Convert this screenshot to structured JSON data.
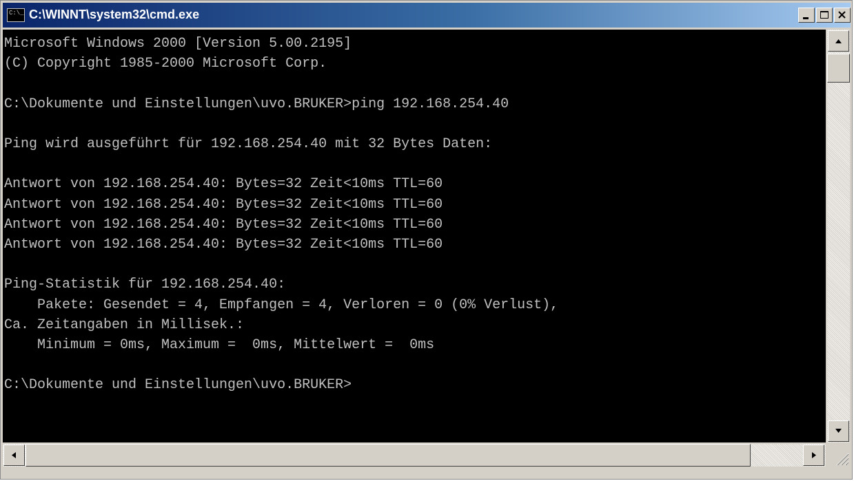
{
  "window": {
    "title": "C:\\WINNT\\system32\\cmd.exe",
    "icon_text": "C:\\_"
  },
  "console": {
    "lines": [
      "Microsoft Windows 2000 [Version 5.00.2195]",
      "(C) Copyright 1985-2000 Microsoft Corp.",
      "",
      "C:\\Dokumente und Einstellungen\\uvo.BRUKER>ping 192.168.254.40",
      "",
      "Ping wird ausgeführt für 192.168.254.40 mit 32 Bytes Daten:",
      "",
      "Antwort von 192.168.254.40: Bytes=32 Zeit<10ms TTL=60",
      "Antwort von 192.168.254.40: Bytes=32 Zeit<10ms TTL=60",
      "Antwort von 192.168.254.40: Bytes=32 Zeit<10ms TTL=60",
      "Antwort von 192.168.254.40: Bytes=32 Zeit<10ms TTL=60",
      "",
      "Ping-Statistik für 192.168.254.40:",
      "    Pakete: Gesendet = 4, Empfangen = 4, Verloren = 0 (0% Verlust),",
      "Ca. Zeitangaben in Millisek.:",
      "    Minimum = 0ms, Maximum =  0ms, Mittelwert =  0ms",
      "",
      "C:\\Dokumente und Einstellungen\\uvo.BRUKER>"
    ]
  },
  "colors": {
    "title_gradient_start": "#0a246a",
    "title_gradient_end": "#a6caf0",
    "console_bg": "#000000",
    "console_fg": "#c0c0c0"
  },
  "icons": {
    "app": "console-icon",
    "minimize": "minimize-icon",
    "maximize": "maximize-icon",
    "close": "close-icon"
  }
}
